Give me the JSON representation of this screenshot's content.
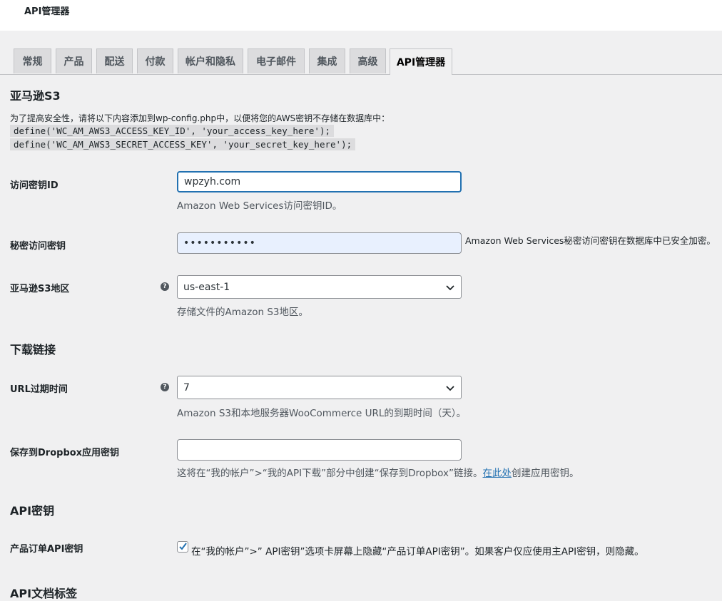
{
  "header": {
    "title": "API管理器"
  },
  "tabs": [
    {
      "label": "常规"
    },
    {
      "label": "产品"
    },
    {
      "label": "配送"
    },
    {
      "label": "付款"
    },
    {
      "label": "帐户和隐私"
    },
    {
      "label": "电子邮件"
    },
    {
      "label": "集成"
    },
    {
      "label": "高级"
    },
    {
      "label": "API管理器",
      "active": true
    }
  ],
  "s3": {
    "heading": "亚马逊S3",
    "note": "为了提高安全性，请将以下内容添加到wp-config.php中，以便将您的AWS密钥不存储在数据库中：",
    "code1": "define('WC_AM_AWS3_ACCESS_KEY_ID', 'your_access_key_here');",
    "code2": "define('WC_AM_AWS3_SECRET_ACCESS_KEY', 'your_secret_key_here');",
    "access_key": {
      "label": "访问密钥ID",
      "value": "wpzyh.com",
      "desc": "Amazon Web Services访问密钥ID。"
    },
    "secret_key": {
      "label": "秘密访问密钥",
      "value": "•••••••••••",
      "desc": "Amazon Web Services秘密访问密钥在数据库中已安全加密。"
    },
    "region": {
      "label": "亚马逊S3地区",
      "value": "us-east-1",
      "desc": "存储文件的Amazon S3地区。"
    }
  },
  "download": {
    "heading": "下载链接",
    "url_expiry": {
      "label": "URL过期时间",
      "value": "7",
      "desc": "Amazon S3和本地服务器WooCommerce URL的到期时间（天）。"
    },
    "dropbox": {
      "label": "保存到Dropbox应用密钥",
      "value": "",
      "desc_before": "这将在“我的帐户”>“我的API下载”部分中创建“保存到Dropbox”链接。",
      "link": "在此处",
      "desc_after": "创建应用密钥。"
    }
  },
  "api_keys": {
    "heading": "API密钥",
    "product_order": {
      "label": "产品订单API密钥",
      "checked": true,
      "text": "在“我的帐户”>” API密钥”选项卡屏幕上隐藏“产品订单API密钥”。如果客户仅应使用主API密钥，则隐藏。"
    }
  },
  "api_docs": {
    "heading": "API文档标签"
  },
  "icons": {
    "help": "help-icon",
    "chevron": "chevron-down-icon",
    "check": "check-icon"
  },
  "colors": {
    "accent": "#2271b1",
    "background": "#f0f0f1"
  }
}
